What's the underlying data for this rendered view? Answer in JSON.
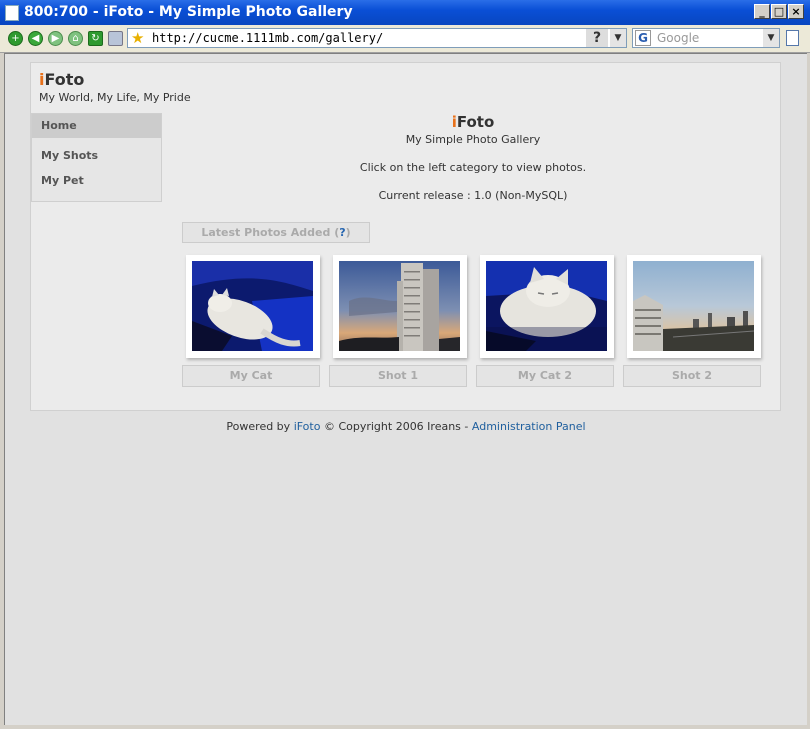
{
  "window": {
    "title": "800:700 - iFoto - My Simple Photo Gallery"
  },
  "toolbar": {
    "url": "http://cucme.1111mb.com/gallery/",
    "search_placeholder": "Google"
  },
  "site": {
    "brand_first": "i",
    "brand_rest": "Foto",
    "tagline": "My World, My Life, My Pride"
  },
  "nav": {
    "home": "Home",
    "items": [
      "My Shots",
      "My Pet"
    ]
  },
  "main": {
    "brand_first": "i",
    "brand_rest": "Foto",
    "subtitle": "My Simple Photo Gallery",
    "instruction": "Click on the left category to view photos.",
    "release": "Current release : 1.0 (Non-MySQL)"
  },
  "latest": {
    "label": "Latest Photos Added (",
    "help": "?",
    "close": ")"
  },
  "photos": [
    {
      "caption": "My Cat"
    },
    {
      "caption": "Shot 1"
    },
    {
      "caption": "My Cat 2"
    },
    {
      "caption": "Shot 2"
    }
  ],
  "footer": {
    "prefix": "Powered by ",
    "brand": "iFoto",
    "middle": " © Copyright 2006 Ireans - ",
    "admin_link": "Administration Panel"
  }
}
